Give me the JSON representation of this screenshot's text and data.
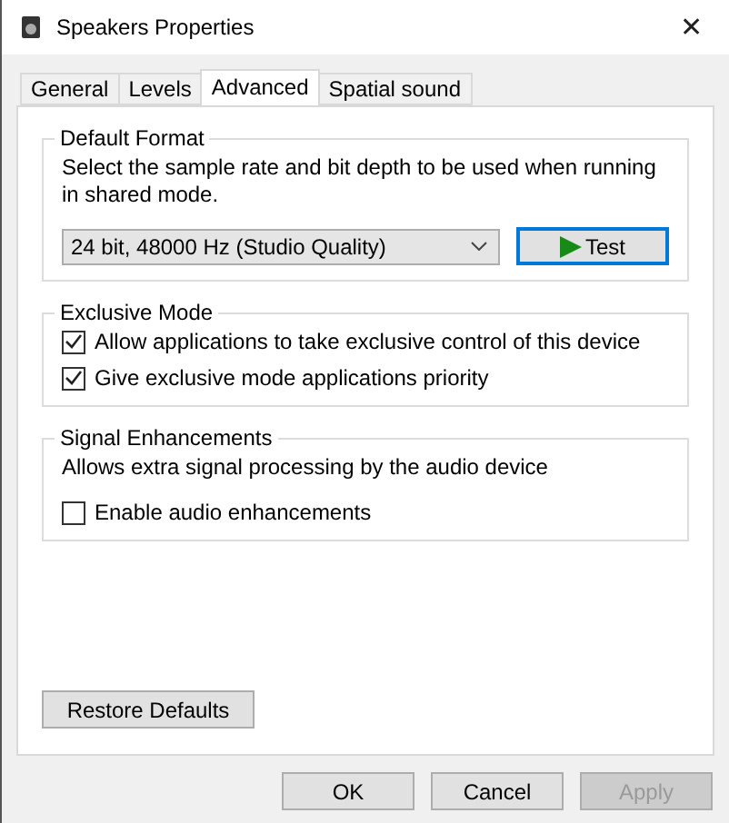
{
  "window": {
    "title": "Speakers Properties",
    "close": "✕"
  },
  "tabs": [
    {
      "label": "General",
      "selected": false
    },
    {
      "label": "Levels",
      "selected": false
    },
    {
      "label": "Advanced",
      "selected": true
    },
    {
      "label": "Spatial sound",
      "selected": false
    }
  ],
  "default_format": {
    "title": "Default Format",
    "description": "Select the sample rate and bit depth to be used when running in shared mode.",
    "format": "24 bit, 48000 Hz (Studio Quality)",
    "test_button": "Test"
  },
  "exclusive_mode": {
    "title": "Exclusive Mode",
    "options": [
      {
        "label": "Allow applications to take exclusive control of this device",
        "checked": true
      },
      {
        "label": "Give exclusive mode applications priority",
        "checked": true
      }
    ]
  },
  "signal_enhancements": {
    "title": "Signal Enhancements",
    "description": "Allows extra signal processing by the audio device",
    "options": [
      {
        "label": "Enable audio enhancements",
        "checked": false
      }
    ]
  },
  "restore_button": "Restore Defaults",
  "buttons": [
    {
      "label": "OK",
      "disabled": false
    },
    {
      "label": "Cancel",
      "disabled": false
    },
    {
      "label": "Apply",
      "disabled": true
    }
  ]
}
